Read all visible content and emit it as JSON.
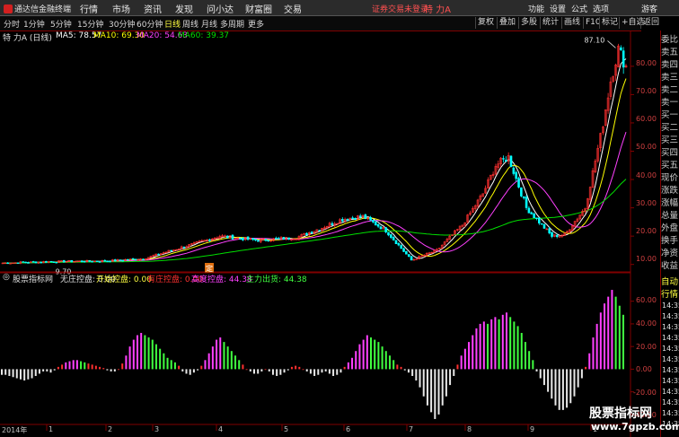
{
  "app": {
    "logo_text": "通达信金融终端",
    "menu": [
      "行情",
      "市场",
      "资讯",
      "发现",
      "问小达",
      "财富圈",
      "交易"
    ],
    "notice": "证券交易未登录",
    "stock_short": "特 力A",
    "right_menu": [
      "功能",
      "设置",
      "公式",
      "选项",
      "游客"
    ]
  },
  "toolbar": {
    "periods": [
      "分时",
      "1分钟",
      "5分钟",
      "15分钟",
      "30分钟",
      "60分钟",
      "日线",
      "周线",
      "月线",
      "多周期",
      "更多"
    ],
    "active_period": "日线",
    "tools": [
      "复权",
      "叠加",
      "多股",
      "统计",
      "画线",
      "F10",
      "标记",
      "+自选",
      "返回"
    ]
  },
  "main_chart": {
    "stock_label": "特 力A (日线)",
    "ma": [
      {
        "label": "MA5: 78.57",
        "color": "#ffffff"
      },
      {
        "label": "MA10: 69.30",
        "color": "#ffff00"
      },
      {
        "label": "MA20: 54.63",
        "color": "#ff40ff"
      },
      {
        "label": "MA60: 39.37",
        "color": "#00e000"
      }
    ],
    "high_label": "87.10",
    "low_label": "9.70",
    "event_badge": "定",
    "y_ticks": [
      "80.00",
      "70.00",
      "60.00",
      "50.00",
      "40.00",
      "30.00",
      "20.00",
      "10.00"
    ]
  },
  "sub_chart": {
    "indicator_name": "股票指标网",
    "fields": [
      {
        "label": "无庄控盘: 0.00",
        "color": "#e0e0e0"
      },
      {
        "label": "开始控盘: 0.00",
        "color": "#ffff40"
      },
      {
        "label": "有庄控盘: 0.00",
        "color": "#ff3030"
      },
      {
        "label": "高度控盘: 44.38",
        "color": "#ff40ff"
      },
      {
        "label": "主力出货: 44.38",
        "color": "#40ff40"
      }
    ],
    "y_ticks": [
      "60.00",
      "40.00",
      "20.00",
      "0.00",
      "-20.00",
      "-40.00"
    ]
  },
  "x_axis": {
    "labels": [
      "2014年",
      "1",
      "2",
      "3",
      "4",
      "5",
      "6",
      "7",
      "8",
      "9",
      "1"
    ]
  },
  "right_panel": {
    "top_labels": [
      "委比",
      "卖五",
      "卖四",
      "卖三",
      "卖二",
      "卖一",
      "买一",
      "买二",
      "买三",
      "买四",
      "买五",
      "现价",
      "涨跌",
      "涨幅",
      "总量",
      "外盘",
      "换手",
      "净资",
      "收益"
    ],
    "bottom_labels": [
      "自动",
      "行情"
    ],
    "times": [
      "14:35",
      "14:35",
      "14:35",
      "14:35",
      "14:35",
      "14:35",
      "14:35",
      "14:35",
      "14:35",
      "14:35",
      "14:35",
      "14:35"
    ]
  },
  "watermark": {
    "title": "股票指标网",
    "url": "www.7gpzb.com"
  },
  "colors": {
    "up": "#ff3030",
    "down": "#00ffff",
    "ma5": "#ffffff",
    "ma10": "#ffff00",
    "ma20": "#ff40ff",
    "ma60": "#00e000",
    "axis": "#800000"
  },
  "chart_data": [
    {
      "type": "candlestick",
      "title": "特 力A (日线)",
      "ylim": [
        8,
        92
      ],
      "y_ticks": [
        10,
        20,
        30,
        40,
        50,
        60,
        70,
        80
      ],
      "x_label": "",
      "y_label": "",
      "anchors": [
        [
          0,
          10.5
        ],
        [
          20,
          11.0
        ],
        [
          40,
          11.2
        ],
        [
          55,
          12.0
        ],
        [
          70,
          16.0
        ],
        [
          85,
          20.0
        ],
        [
          100,
          18.5
        ],
        [
          115,
          19.5
        ],
        [
          125,
          23.0
        ],
        [
          133,
          26.0
        ],
        [
          141,
          27.0
        ],
        [
          150,
          22.0
        ],
        [
          160,
          11.5
        ],
        [
          170,
          15.0
        ],
        [
          180,
          24.0
        ],
        [
          188,
          35.0
        ],
        [
          193,
          45.0
        ],
        [
          198,
          48.0
        ],
        [
          205,
          30.0
        ],
        [
          215,
          20.0
        ],
        [
          220,
          20.5
        ],
        [
          228,
          30.0
        ],
        [
          234,
          55.0
        ],
        [
          238,
          75.0
        ],
        [
          241,
          86.0
        ],
        [
          244,
          80.0
        ]
      ],
      "high": 87.1,
      "low": 9.7,
      "series": [
        {
          "name": "MA5",
          "value": 78.57
        },
        {
          "name": "MA10",
          "value": 69.3
        },
        {
          "name": "MA20",
          "value": 54.63
        },
        {
          "name": "MA60",
          "value": 39.37
        }
      ]
    },
    {
      "type": "bar",
      "title": "股票指标网",
      "ylim": [
        -48,
        74
      ],
      "y_ticks": [
        -40,
        -20,
        0,
        20,
        40,
        60
      ],
      "series": [
        {
          "name": "无庄控盘",
          "value": 0.0
        },
        {
          "name": "开始控盘",
          "value": 0.0
        },
        {
          "name": "有庄控盘",
          "value": 0.0
        },
        {
          "name": "高度控盘",
          "value": 44.38
        },
        {
          "name": "主力出货",
          "value": 44.38
        }
      ],
      "values_by_bar": [
        -5,
        -5,
        -6,
        -7,
        -8,
        -9,
        -10,
        -9,
        -8,
        -6,
        -4,
        -2,
        -2,
        -3,
        -1,
        2,
        4,
        6,
        7,
        8,
        8,
        7,
        6,
        5,
        4,
        3,
        2,
        1,
        -1,
        -2,
        -2,
        0,
        5,
        12,
        20,
        26,
        30,
        32,
        30,
        28,
        26,
        22,
        18,
        14,
        10,
        8,
        6,
        3,
        -2,
        -4,
        -5,
        -3,
        -1,
        3,
        8,
        14,
        20,
        26,
        28,
        24,
        20,
        16,
        12,
        8,
        4,
        0,
        -2,
        -4,
        -4,
        -2,
        0,
        -2,
        -5,
        -6,
        -5,
        -3,
        -1,
        2,
        3,
        2,
        0,
        -2,
        -4,
        -6,
        -5,
        -3,
        -2,
        -4,
        -6,
        -5,
        -3,
        2,
        6,
        10,
        16,
        22,
        26,
        30,
        28,
        26,
        24,
        20,
        16,
        12,
        8,
        4,
        2,
        -1,
        -3,
        -6,
        -10,
        -16,
        -24,
        -32,
        -38,
        -44,
        -40,
        -32,
        -24,
        -14,
        -6,
        4,
        12,
        18,
        24,
        30,
        36,
        40,
        42,
        40,
        44,
        46,
        44,
        48,
        50,
        46,
        42,
        38,
        32,
        24,
        16,
        8,
        -2,
        -8,
        -14,
        -20,
        -26,
        -32,
        -36,
        -36,
        -34,
        -30,
        -24,
        -16,
        -8,
        2,
        14,
        28,
        40,
        50,
        58,
        64,
        70,
        64,
        56,
        48
      ]
    }
  ]
}
